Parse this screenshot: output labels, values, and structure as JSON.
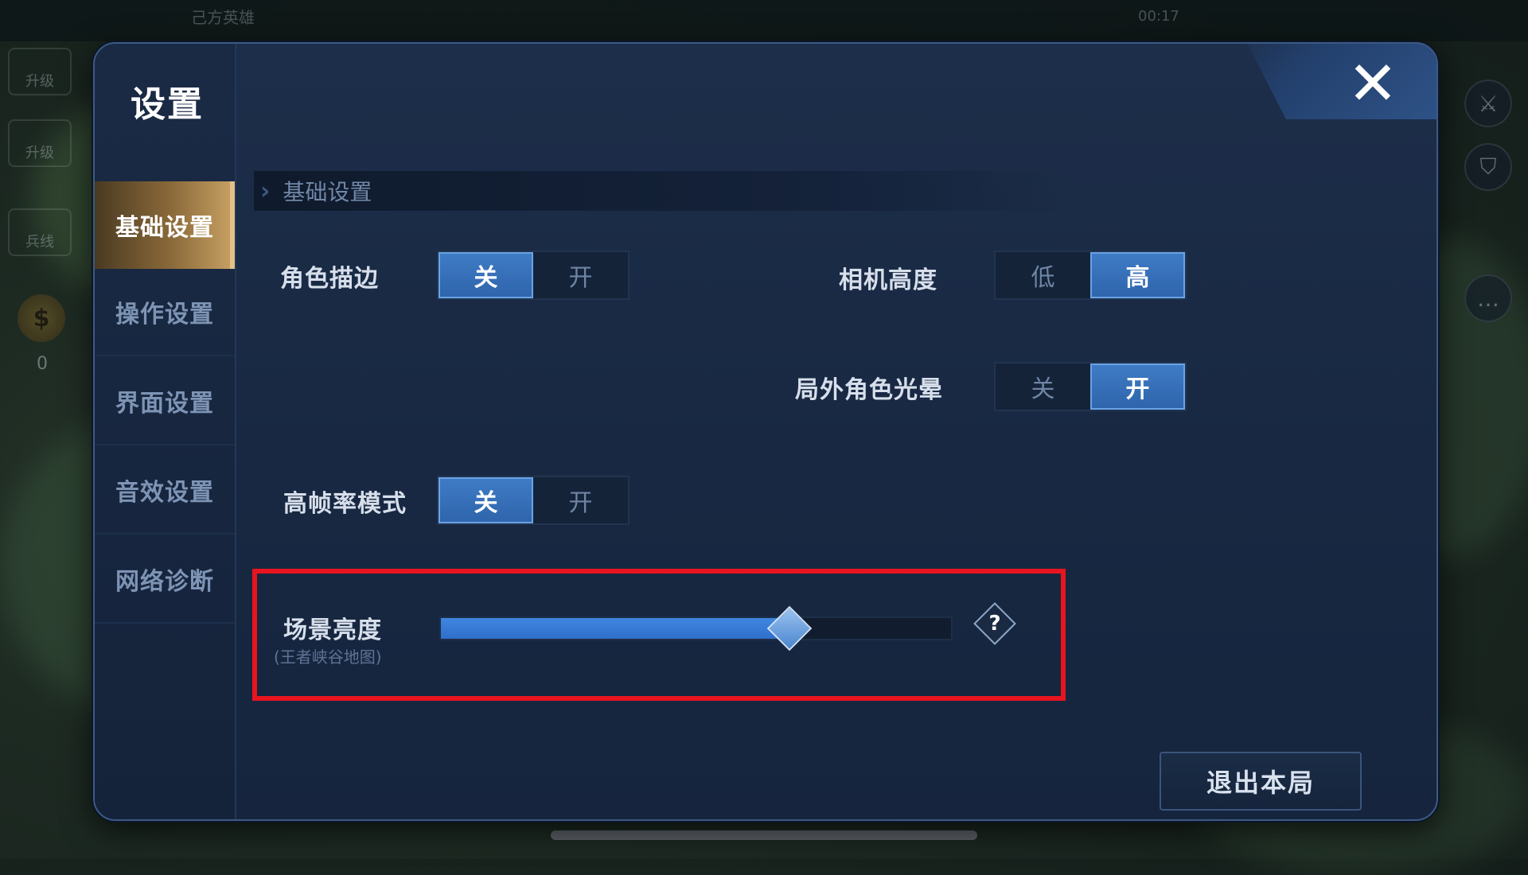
{
  "background": {
    "top_label": "己方英雄",
    "timer": "00:17",
    "left_buttons": [
      "升级",
      "升级",
      "兵线"
    ],
    "coin_symbol": "$",
    "coin_count": "0"
  },
  "dialog": {
    "title": "设置",
    "close_label": "✕",
    "tabs": [
      {
        "label": "基础设置",
        "active": true
      },
      {
        "label": "操作设置",
        "active": false
      },
      {
        "label": "界面设置",
        "active": false
      },
      {
        "label": "音效设置",
        "active": false
      },
      {
        "label": "网络诊断",
        "active": false
      }
    ],
    "section_title": "基础设置",
    "settings": {
      "outline": {
        "label": "角色描边",
        "off": "关",
        "on": "开",
        "selected": "off"
      },
      "camera_height": {
        "label": "相机高度",
        "low": "低",
        "high": "高",
        "selected": "high"
      },
      "halo": {
        "label": "局外角色光晕",
        "off": "关",
        "on": "开",
        "selected": "on"
      },
      "high_fps": {
        "label": "高帧率模式",
        "off": "关",
        "on": "开",
        "selected": "off"
      },
      "brightness": {
        "label": "场景亮度",
        "sublabel": "(王者峡谷地图)",
        "value_fraction": 0.68,
        "help": "?"
      }
    },
    "exit_button": "退出本局"
  },
  "colors": {
    "accent_blue": "#3f7cc6",
    "active_tab_gold": "#c9a264",
    "highlight_red": "#e8141e"
  }
}
